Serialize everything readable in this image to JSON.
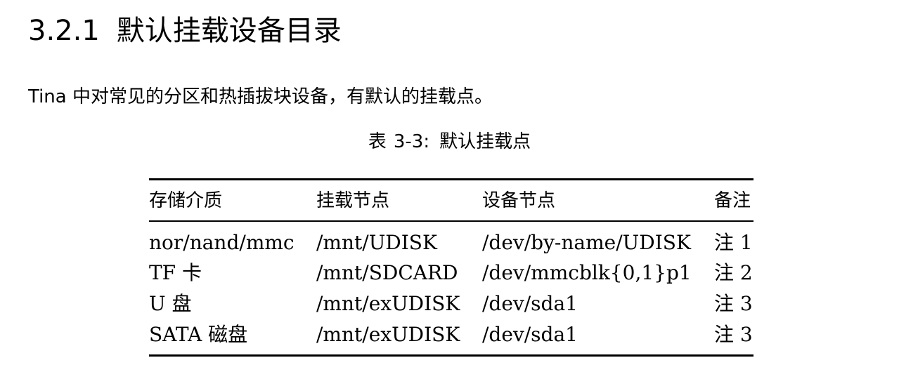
{
  "section": {
    "number": "3.2.1",
    "title": "默认挂载设备目录"
  },
  "intro": "Tina 中对常见的分区和热插拔块设备，有默认的挂载点。",
  "table": {
    "caption_prefix": "表",
    "caption_number": "3-3:",
    "caption_title": "默认挂载点",
    "headers": [
      "存储介质",
      "挂载节点",
      "设备节点",
      "备注"
    ],
    "rows": [
      [
        "nor/nand/mmc",
        "/mnt/UDISK",
        "/dev/by-name/UDISK",
        "注 1"
      ],
      [
        "TF 卡",
        "/mnt/SDCARD",
        "/dev/mmcblk{0,1}p1",
        "注 2"
      ],
      [
        "U 盘",
        "/mnt/exUDISK",
        "/dev/sda1",
        "注 3"
      ],
      [
        "SATA 磁盘",
        "/mnt/exUDISK",
        "/dev/sda1",
        "注 3"
      ]
    ]
  }
}
